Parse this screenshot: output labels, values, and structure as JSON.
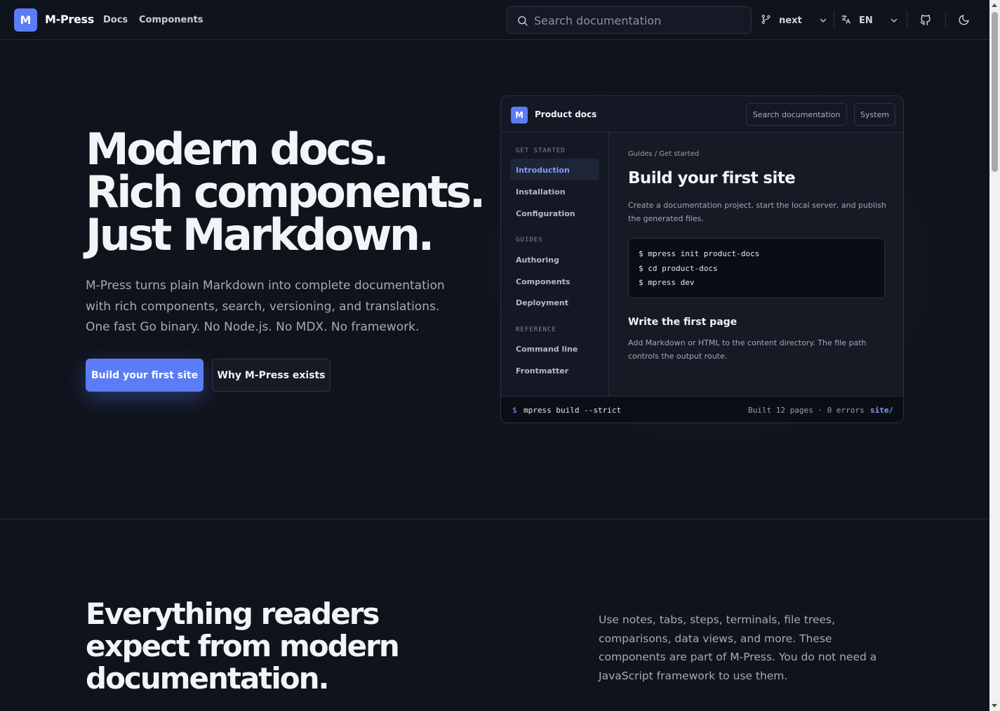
{
  "nav": {
    "logo_letter": "M",
    "brand": "M-Press",
    "links": [
      "Docs",
      "Components"
    ],
    "search_placeholder": "Search documentation",
    "version": "next",
    "language": "EN"
  },
  "hero": {
    "title_lines": [
      "Modern docs.",
      "Rich components.",
      "Just Markdown."
    ],
    "subtitle": "M-Press turns plain Markdown into complete documentation with rich components, search, versioning, and translations. One fast Go binary. No Node.js. No MDX. No framework.",
    "primary_cta": "Build your first site",
    "secondary_cta": "Why M-Press exists"
  },
  "preview": {
    "logo_letter": "M",
    "title": "Product docs",
    "search": "Search documentation",
    "theme": "System",
    "sidebar": {
      "sections": [
        {
          "label": "GET STARTED",
          "items": [
            "Introduction",
            "Installation",
            "Configuration"
          ]
        },
        {
          "label": "GUIDES",
          "items": [
            "Authoring",
            "Components",
            "Deployment"
          ]
        },
        {
          "label": "REFERENCE",
          "items": [
            "Command line",
            "Frontmatter"
          ]
        }
      ],
      "active_item": "Introduction"
    },
    "breadcrumb": "Guides / Get started",
    "heading": "Build your first site",
    "intro": "Create a documentation project, start the local server, and publish the generated files.",
    "code_lines": [
      "$ mpress init product-docs",
      "$ cd product-docs",
      "$ mpress dev"
    ],
    "subheading": "Write the first page",
    "sub_text": "Add Markdown or HTML to the content directory. The file path controls the output route.",
    "footer": {
      "prompt": "$",
      "command": "mpress build --strict",
      "status": "Built 12 pages · 0 errors",
      "output": "site/"
    }
  },
  "features": {
    "title_lines": [
      "Everything readers",
      "expect from modern",
      "documentation."
    ],
    "text": "Use notes, tabs, steps, terminals, file trees, comparisons, data views, and more. These components are part of M-Press. You do not need a JavaScript framework to use them."
  },
  "icons": {
    "search": "search-icon",
    "version": "git-branch-icon",
    "language": "translate-icon",
    "github": "github-icon",
    "theme": "moon-icon"
  },
  "colors": {
    "accent": "#5b7cf5",
    "background": "#0f131b",
    "accent_text": "#7f9bf7"
  }
}
